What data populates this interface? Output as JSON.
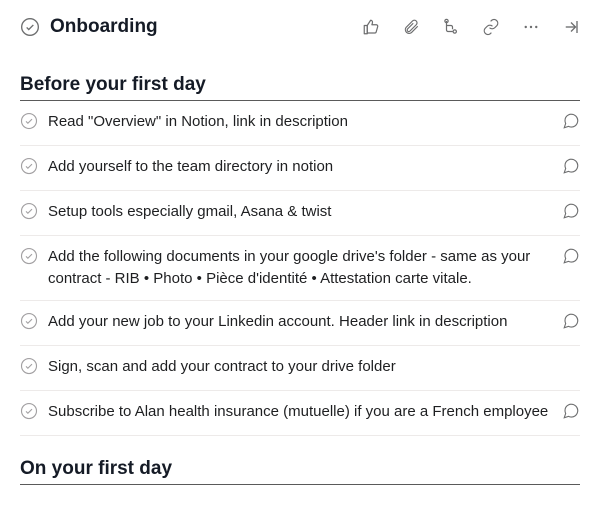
{
  "header": {
    "title": "Onboarding"
  },
  "sections": [
    {
      "heading": "Before your first day",
      "tasks": [
        {
          "text": "Read \"Overview\" in Notion, link in description",
          "hasComment": true
        },
        {
          "text": "Add yourself to the team directory in notion",
          "hasComment": true
        },
        {
          "text": "Setup tools especially gmail, Asana & twist",
          "hasComment": true
        },
        {
          "text": "Add the following documents in your google drive's folder - same as your contract - RIB • Photo • Pièce d'identité • Attestation carte vitale.",
          "hasComment": true
        },
        {
          "text": "Add your new job to your Linkedin account. Header link in description",
          "hasComment": true
        },
        {
          "text": "Sign, scan and add your contract to your drive folder",
          "hasComment": false
        },
        {
          "text": "Subscribe to Alan health insurance (mutuelle) if you are a French employee",
          "hasComment": true
        }
      ]
    },
    {
      "heading": "On your first day",
      "tasks": []
    }
  ]
}
